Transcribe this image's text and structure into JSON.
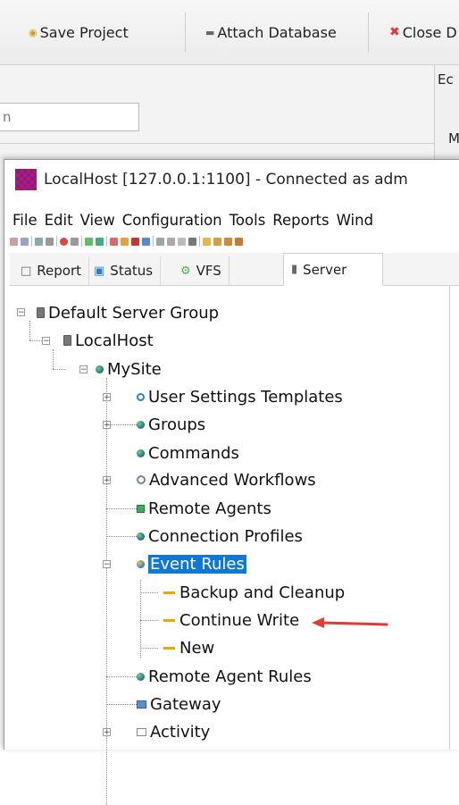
{
  "bg_toolbar": {
    "save_project": "Save Project",
    "attach_database": "Attach Database",
    "close": "Close D"
  },
  "bg_area": {
    "search_value": "n",
    "tab_partial": "Ec",
    "letter_partial": "M"
  },
  "window": {
    "title": "LocalHost [127.0.0.1:1100] - Connected as adm"
  },
  "menu": [
    "File",
    "Edit",
    "View",
    "Configuration",
    "Tools",
    "Reports",
    "Wind"
  ],
  "tabs": [
    {
      "label": "Report",
      "icon": "report-icon"
    },
    {
      "label": "Status",
      "icon": "status-icon"
    },
    {
      "label": "VFS",
      "icon": "vfs-icon"
    },
    {
      "label": "Server",
      "icon": "server-icon",
      "active": true
    }
  ],
  "tree": {
    "root": "Default Server Group",
    "host": "LocalHost",
    "site": "MySite",
    "items": [
      "User Settings Templates",
      "Groups",
      "Commands",
      "Advanced Workflows",
      "Remote Agents",
      "Connection Profiles",
      "Event Rules",
      "Remote Agent Rules",
      "Gateway",
      "Activity"
    ],
    "event_rules_children": [
      "Backup and Cleanup",
      "Continue Write",
      "New"
    ]
  },
  "colors": {
    "selection": "#0f78d7",
    "arrow": "#e53935",
    "rule_dash": "#f0a400"
  }
}
